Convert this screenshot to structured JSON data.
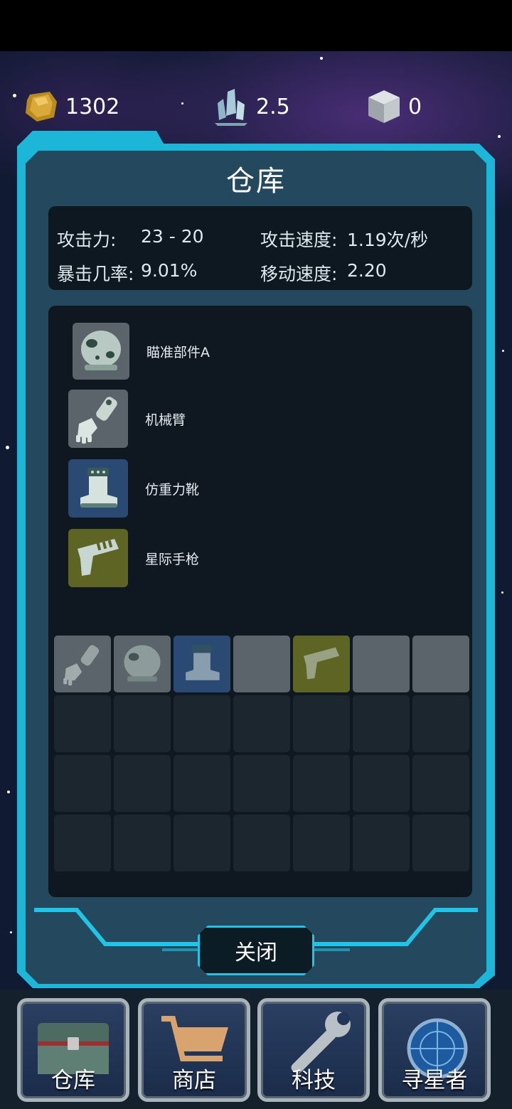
{
  "resources": {
    "gold": "1302",
    "crystal": "2.5",
    "cube": "0",
    "gold_icon": "gold-ore-icon",
    "crystal_icon": "crystal-icon",
    "cube_icon": "metal-cube-icon"
  },
  "panel": {
    "title": "仓库",
    "stats": {
      "attack_label": "攻击力:",
      "attack_value": "23 - 20",
      "attack_speed_label": "攻击速度:",
      "attack_speed_value": "1.19次/秒",
      "crit_label": "暴击几率:",
      "crit_value": "9.01%",
      "move_speed_label": "移动速度:",
      "move_speed_value": "2.20"
    },
    "equipped": [
      {
        "label": "瞄准部件A",
        "icon": "helmet-icon",
        "color": "#5a646a"
      },
      {
        "label": "机械臂",
        "icon": "mech-arm-icon",
        "color": "#5a646a"
      },
      {
        "label": "仿重力靴",
        "icon": "boot-icon",
        "color": "#2a4a74"
      },
      {
        "label": "星际手枪",
        "icon": "pistol-icon",
        "color": "#5e6424"
      }
    ],
    "close_label": "关闭"
  },
  "nav": {
    "items": [
      {
        "label": "仓库",
        "icon": "chest-icon"
      },
      {
        "label": "商店",
        "icon": "cart-icon"
      },
      {
        "label": "科技",
        "icon": "wrench-icon"
      },
      {
        "label": "寻星者",
        "icon": "radar-icon"
      }
    ]
  },
  "colors": {
    "frame_accent": "#1bb6d8",
    "panel_bg": "#24485e",
    "slot_gray": "#5a646a",
    "slot_blue": "#2a4a74",
    "slot_olive": "#5e6424"
  }
}
